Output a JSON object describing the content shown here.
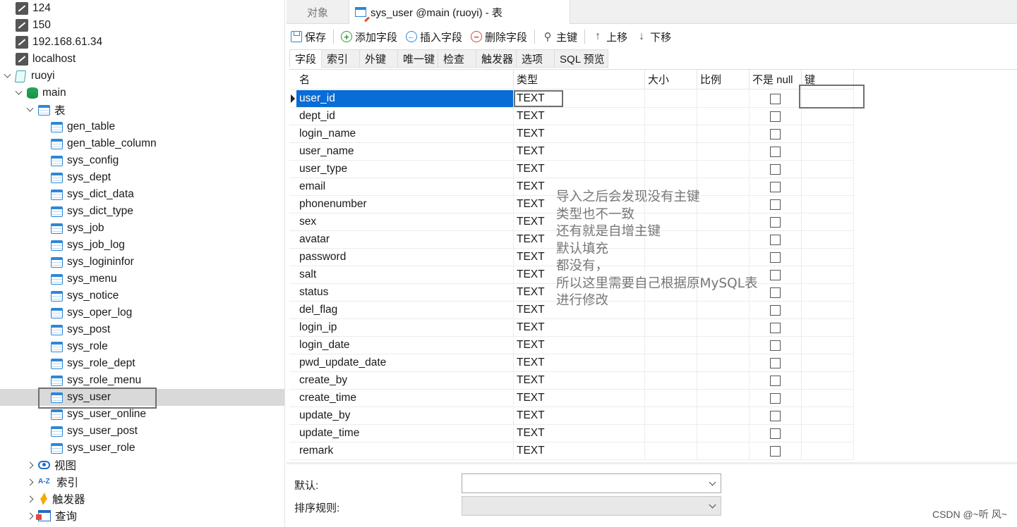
{
  "sidebar": {
    "items": [
      {
        "label": "124",
        "icon": "connection-icon"
      },
      {
        "label": "150",
        "icon": "connection-icon"
      },
      {
        "label": "192.168.61.34",
        "icon": "connection-icon"
      },
      {
        "label": "localhost",
        "icon": "connection-icon"
      },
      {
        "label": "ruoyi",
        "icon": "sqlite-db-icon"
      },
      {
        "label": "main",
        "icon": "schema-icon"
      },
      {
        "label": "表",
        "icon": "tables-folder-icon"
      },
      {
        "label": "gen_table",
        "icon": "table-icon"
      },
      {
        "label": "gen_table_column",
        "icon": "table-icon"
      },
      {
        "label": "sys_config",
        "icon": "table-icon"
      },
      {
        "label": "sys_dept",
        "icon": "table-icon"
      },
      {
        "label": "sys_dict_data",
        "icon": "table-icon"
      },
      {
        "label": "sys_dict_type",
        "icon": "table-icon"
      },
      {
        "label": "sys_job",
        "icon": "table-icon"
      },
      {
        "label": "sys_job_log",
        "icon": "table-icon"
      },
      {
        "label": "sys_logininfor",
        "icon": "table-icon"
      },
      {
        "label": "sys_menu",
        "icon": "table-icon"
      },
      {
        "label": "sys_notice",
        "icon": "table-icon"
      },
      {
        "label": "sys_oper_log",
        "icon": "table-icon"
      },
      {
        "label": "sys_post",
        "icon": "table-icon"
      },
      {
        "label": "sys_role",
        "icon": "table-icon"
      },
      {
        "label": "sys_role_dept",
        "icon": "table-icon"
      },
      {
        "label": "sys_role_menu",
        "icon": "table-icon"
      },
      {
        "label": "sys_user",
        "icon": "table-icon"
      },
      {
        "label": "sys_user_online",
        "icon": "table-icon"
      },
      {
        "label": "sys_user_post",
        "icon": "table-icon"
      },
      {
        "label": "sys_user_role",
        "icon": "table-icon"
      },
      {
        "label": "视图",
        "icon": "view-icon"
      },
      {
        "label": "索引",
        "icon": "index-icon"
      },
      {
        "label": "触发器",
        "icon": "trigger-icon"
      },
      {
        "label": "查询",
        "icon": "query-icon"
      }
    ],
    "selected": "sys_user"
  },
  "tabs": {
    "objects_label": "对象",
    "active_label": "sys_user @main (ruoyi) - 表"
  },
  "toolbar": {
    "save": "保存",
    "add_field": "添加字段",
    "insert_field": "插入字段",
    "delete_field": "删除字段",
    "primary_key": "主键",
    "move_up": "上移",
    "move_down": "下移"
  },
  "subtabs": [
    "字段",
    "索引",
    "外键",
    "唯一键",
    "检查",
    "触发器",
    "选项",
    "SQL 预览"
  ],
  "grid": {
    "headers": {
      "name": "名",
      "type": "类型",
      "size": "大小",
      "scale": "比例",
      "not_null": "不是 null",
      "key": "键"
    },
    "rows": [
      {
        "name": "user_id",
        "type": "TEXT"
      },
      {
        "name": "dept_id",
        "type": "TEXT"
      },
      {
        "name": "login_name",
        "type": "TEXT"
      },
      {
        "name": "user_name",
        "type": "TEXT"
      },
      {
        "name": "user_type",
        "type": "TEXT"
      },
      {
        "name": "email",
        "type": "TEXT"
      },
      {
        "name": "phonenumber",
        "type": "TEXT"
      },
      {
        "name": "sex",
        "type": "TEXT"
      },
      {
        "name": "avatar",
        "type": "TEXT"
      },
      {
        "name": "password",
        "type": "TEXT"
      },
      {
        "name": "salt",
        "type": "TEXT"
      },
      {
        "name": "status",
        "type": "TEXT"
      },
      {
        "name": "del_flag",
        "type": "TEXT"
      },
      {
        "name": "login_ip",
        "type": "TEXT"
      },
      {
        "name": "login_date",
        "type": "TEXT"
      },
      {
        "name": "pwd_update_date",
        "type": "TEXT"
      },
      {
        "name": "create_by",
        "type": "TEXT"
      },
      {
        "name": "create_time",
        "type": "TEXT"
      },
      {
        "name": "update_by",
        "type": "TEXT"
      },
      {
        "name": "update_time",
        "type": "TEXT"
      },
      {
        "name": "remark",
        "type": "TEXT"
      }
    ]
  },
  "annotation": "导入之后会发现没有主键\n类型也不一致\n还有就是自增主键\n默认填充\n都没有，\n所以这里需要自己根据原MySQL表\n进行修改",
  "props": {
    "default_label": "默认:",
    "collation_label": "排序规则:",
    "default_value": "",
    "collation_value": ""
  },
  "watermark": "CSDN @~听 风~",
  "colors": {
    "selection": "#0a6cd5",
    "highlight_box": "#707070"
  }
}
